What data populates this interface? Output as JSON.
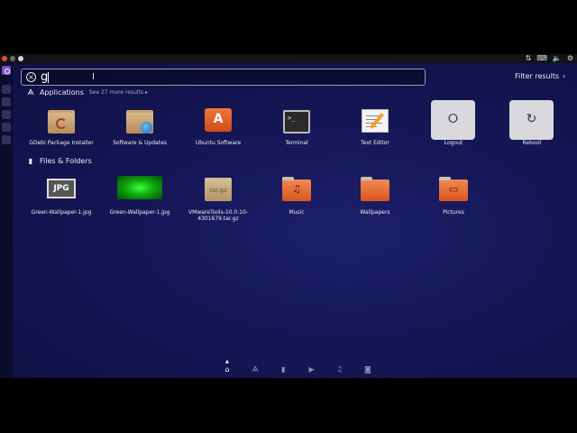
{
  "search": {
    "query": "g"
  },
  "filter_results_label": "Filter results",
  "sections": {
    "applications": {
      "title": "Applications",
      "more": "See 27 more results"
    },
    "files": {
      "title": "Files & Folders"
    }
  },
  "apps": [
    {
      "label": "GDebi Package Installer",
      "icon": "package-installer-icon"
    },
    {
      "label": "Software & Updates",
      "icon": "software-updates-icon"
    },
    {
      "label": "Ubuntu Software",
      "icon": "ubuntu-software-icon"
    },
    {
      "label": "Terminal",
      "icon": "terminal-icon"
    },
    {
      "label": "Text Editor",
      "icon": "text-editor-icon"
    },
    {
      "label": "Logout",
      "icon": "logout-icon"
    },
    {
      "label": "Reboot",
      "icon": "reboot-icon"
    }
  ],
  "files": [
    {
      "label": "Green-Wallpaper-1.jpg",
      "thumb_text": "JPG",
      "icon": "jpg-file-icon"
    },
    {
      "label": "Green-Wallpaper-1.jpg",
      "icon": "green-image-thumbnail"
    },
    {
      "label": "VMwareTools-10.0.10-4301679.tar.gz",
      "thumb_text": "tar.gz",
      "icon": "archive-icon"
    },
    {
      "label": "Music",
      "icon": "music-folder-icon"
    },
    {
      "label": "Wallpapers",
      "icon": "folder-icon"
    },
    {
      "label": "Pictures",
      "icon": "pictures-folder-icon"
    }
  ],
  "lenses": [
    "home-lens-icon",
    "applications-lens-icon",
    "files-lens-icon",
    "video-lens-icon",
    "music-lens-icon",
    "photos-lens-icon"
  ],
  "colors": {
    "dash_bg": "#151656",
    "folder_orange": "#e0652a",
    "launcher_accent": "#7a4fc8"
  }
}
